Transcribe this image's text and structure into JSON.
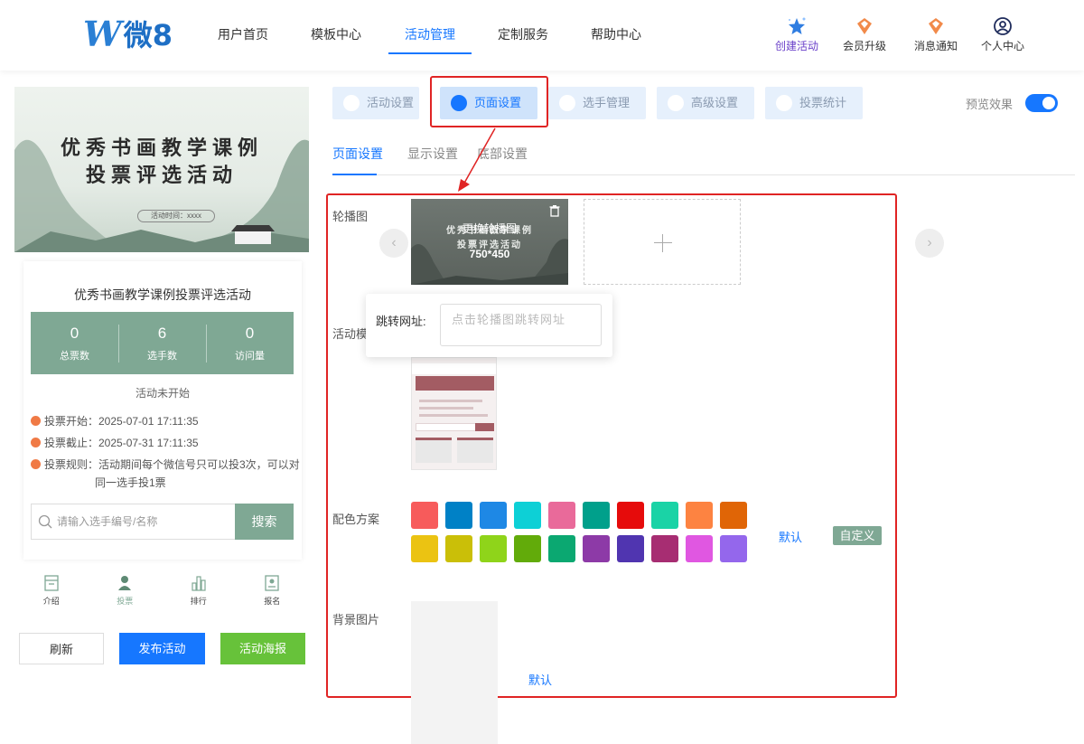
{
  "header": {
    "logo": {
      "w": "W",
      "text": "微8"
    },
    "nav": [
      "用户首页",
      "模板中心",
      "活动管理",
      "定制服务",
      "帮助中心"
    ],
    "active_nav": "活动管理",
    "icons": [
      {
        "label": "创建活动",
        "icon": "star-icon"
      },
      {
        "label": "会员升级",
        "icon": "crown-icon"
      },
      {
        "label": "消息通知",
        "icon": "bell-icon"
      },
      {
        "label": "个人中心",
        "icon": "user-icon"
      }
    ]
  },
  "preview": {
    "banner": {
      "line1": "优秀书画教学课例",
      "line2": "投票评选活动",
      "time": "活动时间：xxxx"
    },
    "title": "优秀书画教学课例投票评选活动",
    "stats": [
      {
        "num": "0",
        "label": "总票数"
      },
      {
        "num": "6",
        "label": "选手数"
      },
      {
        "num": "0",
        "label": "访问量"
      }
    ],
    "status": "活动未开始",
    "vote_start": "投票开始：2025-07-01 17:11:35",
    "vote_end": "投票截止：2025-07-31 17:11:35",
    "rule_line1": "投票规则：活动期间每个微信号只可以投3次，可以对",
    "rule_line2": "同一选手投1票",
    "search_placeholder": "请输入选手编号/名称",
    "search_button": "搜索",
    "bottom_tabs": [
      {
        "label": "介绍",
        "icon": "intro-icon"
      },
      {
        "label": "投票",
        "icon": "person-icon"
      },
      {
        "label": "排行",
        "icon": "ranking-icon"
      },
      {
        "label": "报名",
        "icon": "signup-icon"
      }
    ],
    "buttons": {
      "refresh": "刷新",
      "publish": "发布活动",
      "poster": "活动海报"
    }
  },
  "settings": {
    "tabs": [
      "活动设置",
      "页面设置",
      "选手管理",
      "高级设置",
      "投票统计"
    ],
    "active_tab": "页面设置",
    "preview_label": "预览效果",
    "preview_on": true,
    "subtabs": [
      "页面设置",
      "显示设置",
      "底部设置"
    ],
    "active_subtab": "页面设置",
    "carousel_label": "轮播图",
    "carousel_overlay": "更换轮播图",
    "carousel_size": "750*450",
    "template_label": "活动模",
    "url_label": "跳转网址:",
    "url_placeholder": "点击轮播图跳转网址",
    "color_label": "配色方案",
    "colors": [
      "#f75b5b",
      "#0081c6",
      "#1e88e5",
      "#0dd0d6",
      "#e96a9a",
      "#00a08b",
      "#e60b0b",
      "#1ad3a6",
      "#fd8341",
      "#e06506",
      "#ebc312",
      "#cabf08",
      "#8fd41a",
      "#62ab0a",
      "#0ba871",
      "#8d3aa7",
      "#5035b0",
      "#a72d72",
      "#e057e1",
      "#9467ec"
    ],
    "default_label": "默认",
    "custom_label": "自定义",
    "bg_label": "背景图片",
    "bg_default": "默认"
  }
}
